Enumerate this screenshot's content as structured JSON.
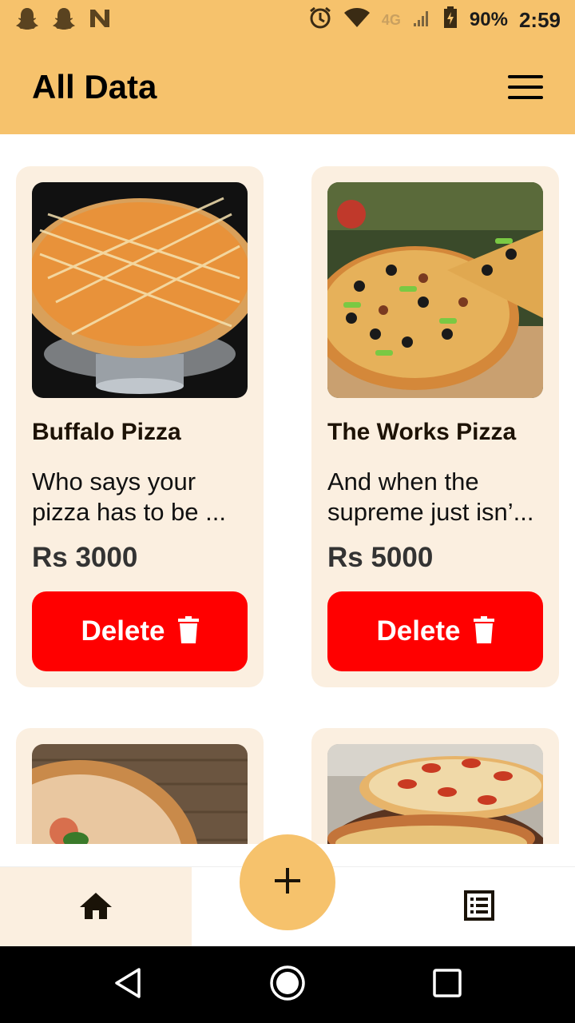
{
  "status_bar": {
    "battery": "90%",
    "time": "2:59",
    "network": "4G"
  },
  "app_bar": {
    "title": "All Data"
  },
  "items": [
    {
      "name": "Buffalo Pizza",
      "description": "Who says your pizza has to be ...",
      "price": "Rs 3000",
      "delete_label": "Delete"
    },
    {
      "name": "The Works Pizza",
      "description": "And when the supreme just isn’...",
      "price": "Rs 5000",
      "delete_label": "Delete"
    },
    {
      "name": "",
      "description": "",
      "price": "",
      "delete_label": ""
    },
    {
      "name": "",
      "description": "",
      "price": "",
      "delete_label": ""
    }
  ],
  "colors": {
    "accent": "#F6C26C",
    "card_bg": "#FBEFE0",
    "delete": "#FF0000"
  }
}
